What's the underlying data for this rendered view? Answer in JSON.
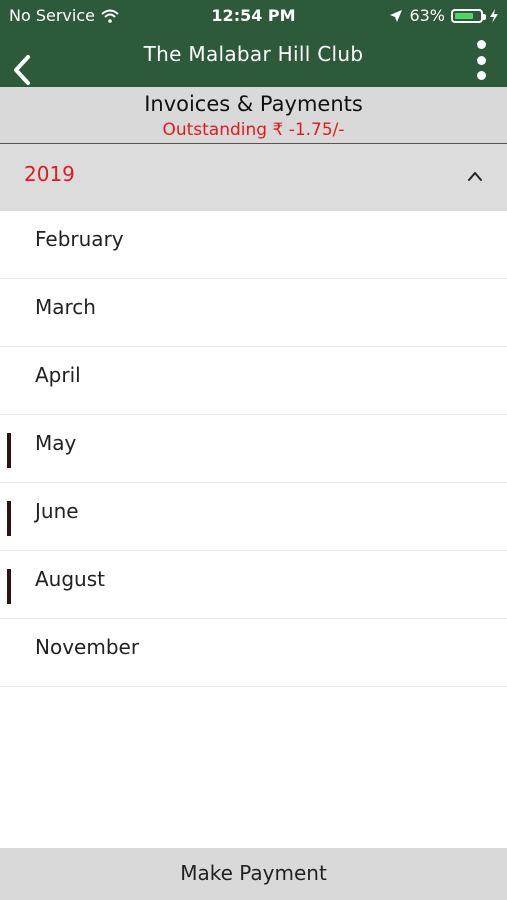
{
  "status_bar": {
    "carrier": "No Service",
    "time": "12:54 PM",
    "battery": "63%",
    "battery_level": 0.63
  },
  "nav": {
    "title": "The Malabar Hill Club"
  },
  "header": {
    "title": "Invoices & Payments",
    "outstanding": "Outstanding  ₹ -1.75/-"
  },
  "year_section": {
    "year": "2019",
    "expanded": true
  },
  "months": [
    {
      "label": "February",
      "marked": false
    },
    {
      "label": "March",
      "marked": false
    },
    {
      "label": "April",
      "marked": false
    },
    {
      "label": "May",
      "marked": true
    },
    {
      "label": "June",
      "marked": true
    },
    {
      "label": "August",
      "marked": true
    },
    {
      "label": "November",
      "marked": false
    }
  ],
  "footer": {
    "make_payment": "Make Payment"
  },
  "colors": {
    "nav_green": "#2d5a3a",
    "accent_red": "#e01b1b",
    "band_gray": "#d9d9d9",
    "marker": "#2a1414"
  }
}
